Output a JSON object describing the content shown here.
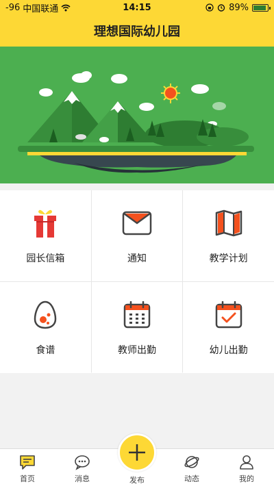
{
  "status_bar": {
    "signal": "-96",
    "carrier": "中国联通",
    "time": "14:15",
    "battery_percent": "89%",
    "battery_level": 0.89
  },
  "header": {
    "title": "理想国际幼儿园"
  },
  "menu": [
    {
      "label": "园长信箱",
      "icon": "gift-icon"
    },
    {
      "label": "通知",
      "icon": "envelope-icon"
    },
    {
      "label": "教学计划",
      "icon": "folded-map-icon"
    },
    {
      "label": "食谱",
      "icon": "egg-icon"
    },
    {
      "label": "教师出勤",
      "icon": "calendar-grid-icon"
    },
    {
      "label": "幼儿出勤",
      "icon": "calendar-check-icon"
    }
  ],
  "tabbar": {
    "home": "首页",
    "messages": "消息",
    "publish": "发布",
    "moments": "动态",
    "mine": "我的"
  },
  "colors": {
    "accent": "#fdd835",
    "banner_green": "#4caf50",
    "icon_red": "#e53935",
    "icon_orange": "#f4511e"
  }
}
